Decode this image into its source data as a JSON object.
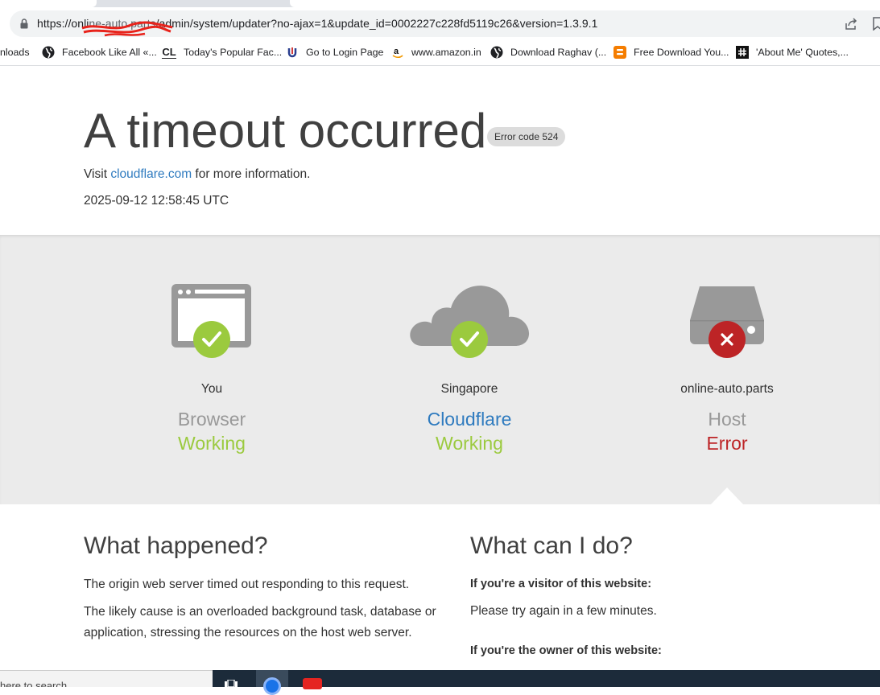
{
  "browser": {
    "url": "https://online-auto.parts/admin/system/updater?no-ajax=1&update_id=0002227c228fd5119c26&version=1.3.9.1",
    "url_display": "https://onli",
    "url_rest": "/admin/system/updater?no-ajax=1&update_id=0002227c228fd5119c26&version=1.3.9.1",
    "url_redacted": "ne-auto.parts",
    "icons": {
      "lock": "lock-icon",
      "share": "share-icon",
      "bookmark": "bookmark-star-icon"
    }
  },
  "bookmarks": [
    {
      "label": "nloads",
      "icon": "none"
    },
    {
      "label": "Facebook Like All «...",
      "icon": "globe-icon"
    },
    {
      "label": "Today's Popular Fac...",
      "icon": "cl-logo-icon"
    },
    {
      "label": "Go to Login Page",
      "icon": "u-logo-icon"
    },
    {
      "label": "www.amazon.in",
      "icon": "amazon-icon"
    },
    {
      "label": "Download Raghav (...",
      "icon": "globe-icon"
    },
    {
      "label": "Free Download You...",
      "icon": "blogger-icon"
    },
    {
      "label": "'About Me' Quotes,...",
      "icon": "hashtag-icon"
    }
  ],
  "header": {
    "title": "A timeout occurred",
    "error_code": "Error code 524",
    "visit_prefix": "Visit ",
    "visit_link": "cloudflare.com",
    "visit_suffix": " for more information.",
    "timestamp": "2025-09-12 12:58:45 UTC"
  },
  "status": [
    {
      "location": "You",
      "role": "Browser",
      "state": "Working",
      "result": "ok",
      "icon": "browser-window-icon"
    },
    {
      "location": "Singapore",
      "role": "Cloudflare",
      "state": "Working",
      "result": "ok",
      "icon": "cloud-icon"
    },
    {
      "location": "online-auto.parts",
      "role": "Host",
      "state": "Error",
      "result": "error",
      "icon": "server-drive-icon"
    }
  ],
  "colors": {
    "working": "#9bca3e",
    "error": "#bd2426",
    "link": "#2f7bbf",
    "band": "#ebebeb"
  },
  "what_happened": {
    "heading": "What happened?",
    "p1": "The origin web server timed out responding to this request.",
    "p2": "The likely cause is an overloaded background task, database or application, stressing the resources on the host web server."
  },
  "what_can_i_do": {
    "heading": "What can I do?",
    "visitor_heading": "If you're a visitor of this website:",
    "visitor_text": "Please try again in a few minutes.",
    "owner_heading": "If you're the owner of this website:"
  },
  "taskbar": {
    "search_placeholder": "here to search",
    "icons": [
      "task-view-icon",
      "chrome-icon",
      "yandex-music-icon"
    ]
  }
}
